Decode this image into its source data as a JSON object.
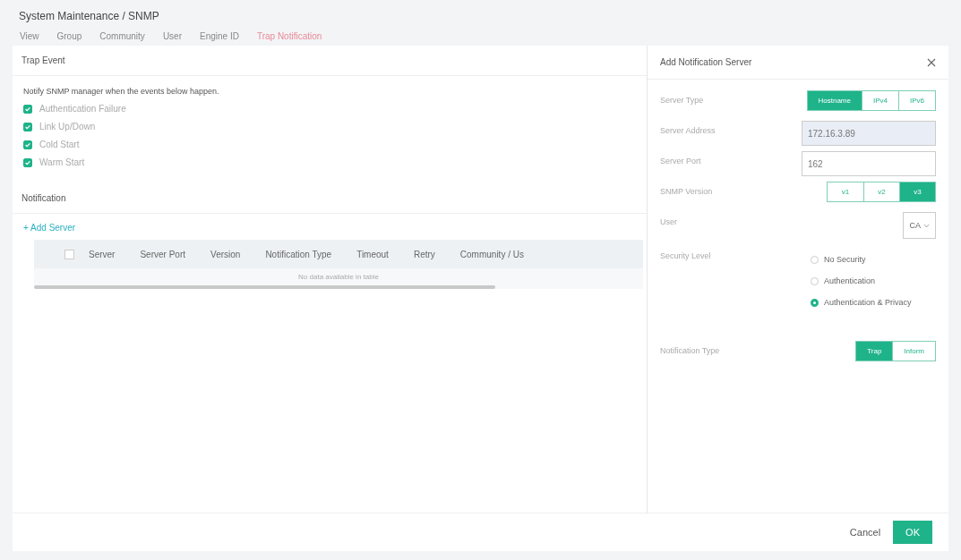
{
  "breadcrumb": "System Maintenance / SNMP",
  "tabs": [
    {
      "label": "View",
      "selected": false
    },
    {
      "label": "Group",
      "selected": false
    },
    {
      "label": "Community",
      "selected": false
    },
    {
      "label": "User",
      "selected": false
    },
    {
      "label": "Engine ID",
      "selected": false
    },
    {
      "label": "Trap Notification",
      "selected": true
    }
  ],
  "trap_event": {
    "title": "Trap Event",
    "description": "Notify SNMP manager when the events below happen.",
    "events": [
      {
        "label": "Authentication Failure",
        "checked": true
      },
      {
        "label": "Link Up/Down",
        "checked": true
      },
      {
        "label": "Cold Start",
        "checked": true
      },
      {
        "label": "Warm Start",
        "checked": true
      }
    ]
  },
  "notification": {
    "title": "Notification",
    "add_button": "+ Add Server",
    "select_all_checked": false,
    "columns": [
      "Server",
      "Server Port",
      "Version",
      "Notification Type",
      "Timeout",
      "Retry",
      "Community / Us"
    ],
    "empty_message": "No data available in table"
  },
  "dialog": {
    "title": "Add Notification Server",
    "fields": [
      {
        "kind": "segmented",
        "label": "Server Type",
        "options": [
          {
            "label": "Hostname",
            "selected": true
          },
          {
            "label": "IPv4",
            "selected": false
          },
          {
            "label": "IPv6",
            "selected": false
          }
        ]
      },
      {
        "kind": "input",
        "label": "Server Address",
        "value": "172.16.3.89",
        "disabled": true
      },
      {
        "kind": "input",
        "label": "Server Port",
        "value": "162",
        "disabled": false
      },
      {
        "kind": "segmented",
        "label": "SNMP Version",
        "options": [
          {
            "label": "v1",
            "selected": false
          },
          {
            "label": "v2",
            "selected": false
          },
          {
            "label": "v3",
            "selected": true
          }
        ]
      },
      {
        "kind": "select",
        "label": "User",
        "value": "CA"
      },
      {
        "kind": "radio",
        "label": "Security Level",
        "options": [
          {
            "label": "No Security",
            "selected": false
          },
          {
            "label": "Authentication",
            "selected": false
          },
          {
            "label": "Authentication & Privacy",
            "selected": true
          }
        ]
      },
      {
        "kind": "segmented",
        "label": "Notification Type",
        "options": [
          {
            "label": "Trap",
            "selected": true
          },
          {
            "label": "Inform",
            "selected": false
          }
        ]
      }
    ],
    "buttons": {
      "cancel": "Cancel",
      "ok": "OK"
    }
  }
}
